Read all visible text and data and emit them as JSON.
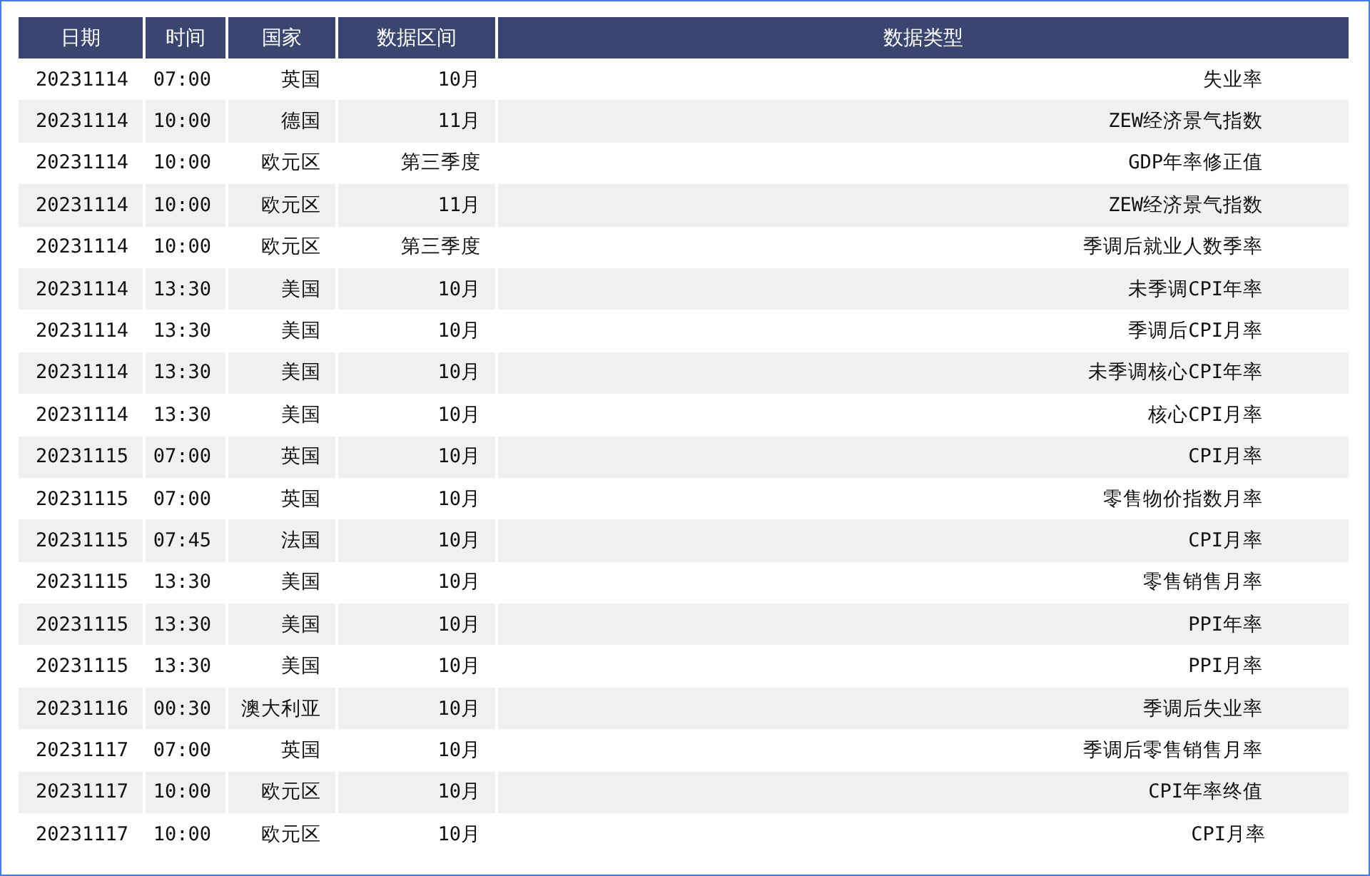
{
  "table": {
    "columns": [
      "日期",
      "时间",
      "国家",
      "数据区间",
      "数据类型"
    ],
    "rows": [
      [
        "20231114",
        "07:00",
        "英国",
        "10月",
        "失业率"
      ],
      [
        "20231114",
        "10:00",
        "德国",
        "11月",
        "ZEW经济景气指数"
      ],
      [
        "20231114",
        "10:00",
        "欧元区",
        "第三季度",
        "GDP年率修正值"
      ],
      [
        "20231114",
        "10:00",
        "欧元区",
        "11月",
        "ZEW经济景气指数"
      ],
      [
        "20231114",
        "10:00",
        "欧元区",
        "第三季度",
        "季调后就业人数季率"
      ],
      [
        "20231114",
        "13:30",
        "美国",
        "10月",
        "未季调CPI年率"
      ],
      [
        "20231114",
        "13:30",
        "美国",
        "10月",
        "季调后CPI月率"
      ],
      [
        "20231114",
        "13:30",
        "美国",
        "10月",
        "未季调核心CPI年率"
      ],
      [
        "20231114",
        "13:30",
        "美国",
        "10月",
        "核心CPI月率"
      ],
      [
        "20231115",
        "07:00",
        "英国",
        "10月",
        "CPI月率"
      ],
      [
        "20231115",
        "07:00",
        "英国",
        "10月",
        "零售物价指数月率"
      ],
      [
        "20231115",
        "07:45",
        "法国",
        "10月",
        "CPI月率"
      ],
      [
        "20231115",
        "13:30",
        "美国",
        "10月",
        "零售销售月率"
      ],
      [
        "20231115",
        "13:30",
        "美国",
        "10月",
        "PPI年率"
      ],
      [
        "20231115",
        "13:30",
        "美国",
        "10月",
        "PPI月率"
      ],
      [
        "20231116",
        "00:30",
        "澳大利亚",
        "10月",
        "季调后失业率"
      ],
      [
        "20231117",
        "07:00",
        "英国",
        "10月",
        "季调后零售销售月率"
      ],
      [
        "20231117",
        "10:00",
        "欧元区",
        "10月",
        "CPI年率终值"
      ],
      [
        "20231117",
        "10:00",
        "欧元区",
        "10月",
        "CPI月率"
      ]
    ]
  }
}
